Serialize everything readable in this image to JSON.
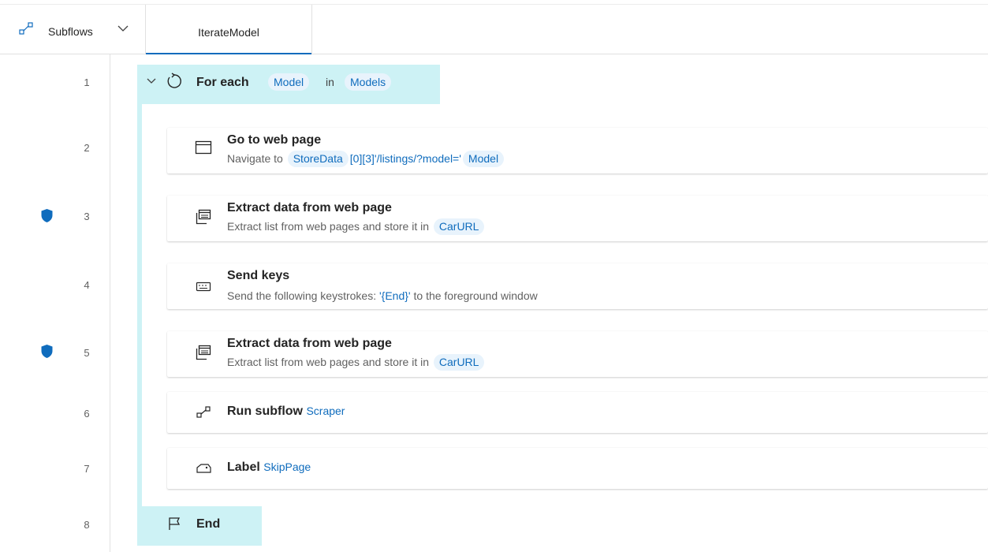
{
  "header": {
    "subflows_label": "Subflows",
    "tab_label": "IterateModel"
  },
  "colors": {
    "accent": "#0f6cbd",
    "loop_bg": "#cdf2f5",
    "pill_bg": "#e8f3fc",
    "shield": "#0f6cbd"
  },
  "lines": [
    "1",
    "2",
    "3",
    "4",
    "5",
    "6",
    "7",
    "8"
  ],
  "foreach": {
    "label": "For each",
    "item_var": "Model",
    "in_label": "in",
    "list_var": "Models"
  },
  "actions": [
    {
      "icon": "browser-window-icon",
      "title": "Go to web page",
      "desc_prefix": "Navigate to",
      "var1": "StoreData",
      "mid_text": "[0][3]'/listings/?model='",
      "var2": "Model"
    },
    {
      "icon": "extract-data-icon",
      "title": "Extract data from web page",
      "desc_prefix": "Extract list from web pages and store it in",
      "var1": "CarURL"
    },
    {
      "icon": "keyboard-icon",
      "title": "Send keys",
      "desc_prefix": "Send the following keystrokes:",
      "keys": "'{End}'",
      "desc_suffix": "to the foreground window"
    },
    {
      "icon": "extract-data-icon",
      "title": "Extract data from web page",
      "desc_prefix": "Extract list from web pages and store it in",
      "var1": "CarURL"
    },
    {
      "icon": "subflow-icon",
      "title": "Run subflow",
      "target": "Scraper"
    },
    {
      "icon": "label-icon",
      "title": "Label",
      "target": "SkipPage"
    }
  ],
  "end_label": "End"
}
